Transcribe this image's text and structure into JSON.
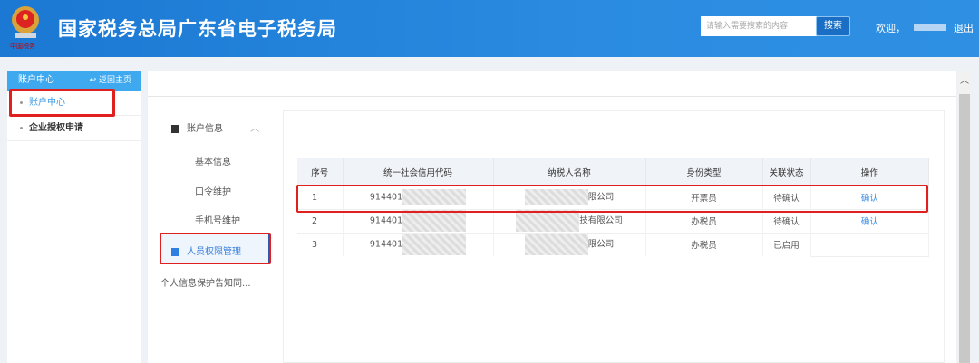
{
  "header": {
    "title": "国家税务总局广东省电子税务局",
    "search_placeholder": "请输入需要搜索的内容",
    "search_button": "搜索",
    "welcome": "欢迎，",
    "logout": "退出"
  },
  "sidebar": {
    "title": "账户中心",
    "back": "返回主页",
    "items": [
      {
        "label": "账户中心"
      },
      {
        "label": "企业授权申请"
      }
    ]
  },
  "nav": {
    "group": "账户信息",
    "items": [
      "基本信息",
      "口令维护",
      "手机号维护",
      "人员权限管理",
      "个人信息保护告知同..."
    ]
  },
  "table": {
    "headers": [
      "序号",
      "统一社会信用代码",
      "纳税人名称",
      "身份类型",
      "关联状态",
      "操作"
    ],
    "rows": [
      {
        "no": "1",
        "code": "914401",
        "name": "限公司",
        "type": "开票员",
        "status": "待确认",
        "action": "确认"
      },
      {
        "no": "2",
        "code": "914401",
        "name": "技有限公司",
        "type": "办税员",
        "status": "待确认",
        "action": "确认"
      },
      {
        "no": "3",
        "code": "914401",
        "name": "限公司",
        "type": "办税员",
        "status": "已启用",
        "action": ""
      }
    ]
  },
  "colors": {
    "header": "#1b78d3",
    "sidebar_head": "#3fa9f0",
    "highlight": "#e0201f",
    "link": "#3a8ee6"
  }
}
